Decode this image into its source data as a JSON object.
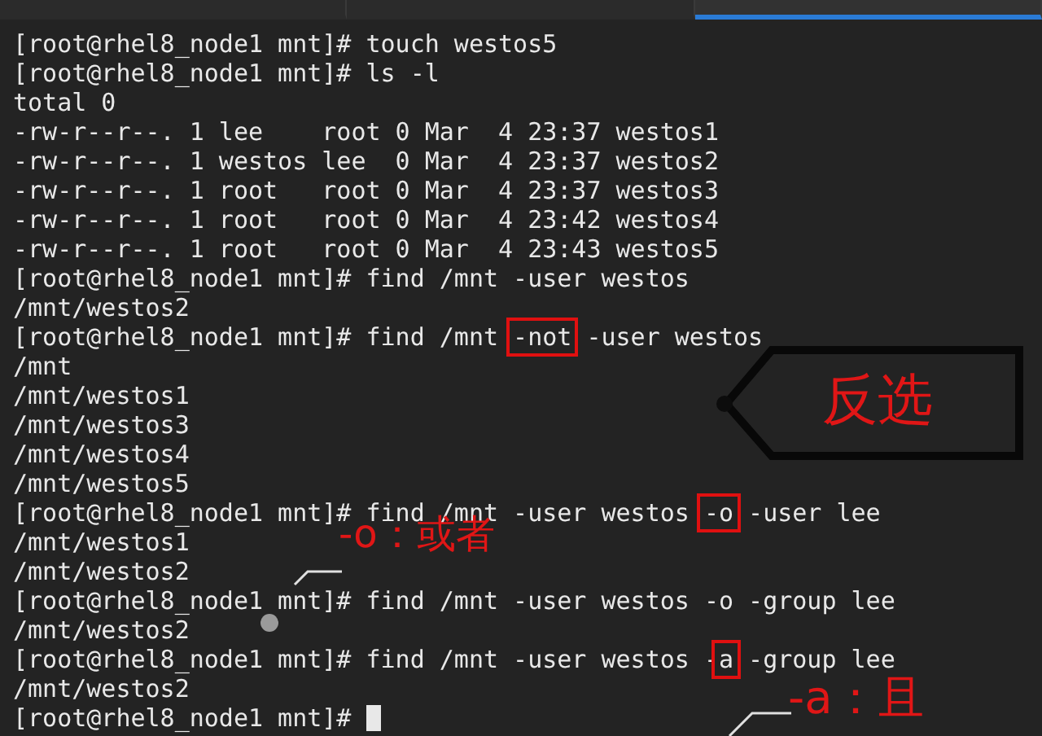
{
  "tabs": [
    {
      "selected": false
    },
    {
      "selected": false
    },
    {
      "selected": true
    }
  ],
  "terminal": {
    "lines": [
      [
        {
          "text": "[root@rhel8_node1 mnt]# touch westos5",
          "boxed": false
        }
      ],
      [
        {
          "text": "[root@rhel8_node1 mnt]# ls -l",
          "boxed": false
        }
      ],
      [
        {
          "text": "total 0",
          "boxed": false
        }
      ],
      [
        {
          "text": "-rw-r--r--. 1 lee    root 0 Mar  4 23:37 westos1",
          "boxed": false
        }
      ],
      [
        {
          "text": "-rw-r--r--. 1 westos lee  0 Mar  4 23:37 westos2",
          "boxed": false
        }
      ],
      [
        {
          "text": "-rw-r--r--. 1 root   root 0 Mar  4 23:37 westos3",
          "boxed": false
        }
      ],
      [
        {
          "text": "-rw-r--r--. 1 root   root 0 Mar  4 23:42 westos4",
          "boxed": false
        }
      ],
      [
        {
          "text": "-rw-r--r--. 1 root   root 0 Mar  4 23:43 westos5",
          "boxed": false
        }
      ],
      [
        {
          "text": "[root@rhel8_node1 mnt]# find /mnt -user westos",
          "boxed": false
        }
      ],
      [
        {
          "text": "/mnt/westos2",
          "boxed": false
        }
      ],
      [
        {
          "text": "[root@rhel8_node1 mnt]# find /mnt ",
          "boxed": false
        },
        {
          "text": "-not",
          "boxed": true
        },
        {
          "text": " -user westos",
          "boxed": false
        }
      ],
      [
        {
          "text": "/mnt",
          "boxed": false
        }
      ],
      [
        {
          "text": "/mnt/westos1",
          "boxed": false
        }
      ],
      [
        {
          "text": "/mnt/westos3",
          "boxed": false
        }
      ],
      [
        {
          "text": "/mnt/westos4",
          "boxed": false
        }
      ],
      [
        {
          "text": "/mnt/westos5",
          "boxed": false
        }
      ],
      [
        {
          "text": "[root@rhel8_node1 mnt]# find /mnt -user westos ",
          "boxed": false
        },
        {
          "text": "-o",
          "boxed": true
        },
        {
          "text": " -user lee",
          "boxed": false
        }
      ],
      [
        {
          "text": "/mnt/westos1",
          "boxed": false
        }
      ],
      [
        {
          "text": "/mnt/westos2",
          "boxed": false
        }
      ],
      [
        {
          "text": "[root@rhel8_node1 mnt]# find /mnt -user westos -o -group lee",
          "boxed": false
        }
      ],
      [
        {
          "text": "/mnt/westos2",
          "boxed": false
        }
      ],
      [
        {
          "text": "[root@rhel8_node1 mnt]# find /mnt -user westos -",
          "boxed": false
        },
        {
          "text": "a",
          "boxed": true
        },
        {
          "text": " -group lee",
          "boxed": false
        }
      ],
      [
        {
          "text": "/mnt/westos2",
          "boxed": false
        }
      ],
      [
        {
          "text": "[root@rhel8_node1 mnt]# ",
          "boxed": false
        }
      ]
    ]
  },
  "annotations": [
    {
      "kind": "callout",
      "text": "反选"
    },
    {
      "kind": "label",
      "text": "-o：或者"
    },
    {
      "kind": "label",
      "text": "-a：且"
    }
  ]
}
